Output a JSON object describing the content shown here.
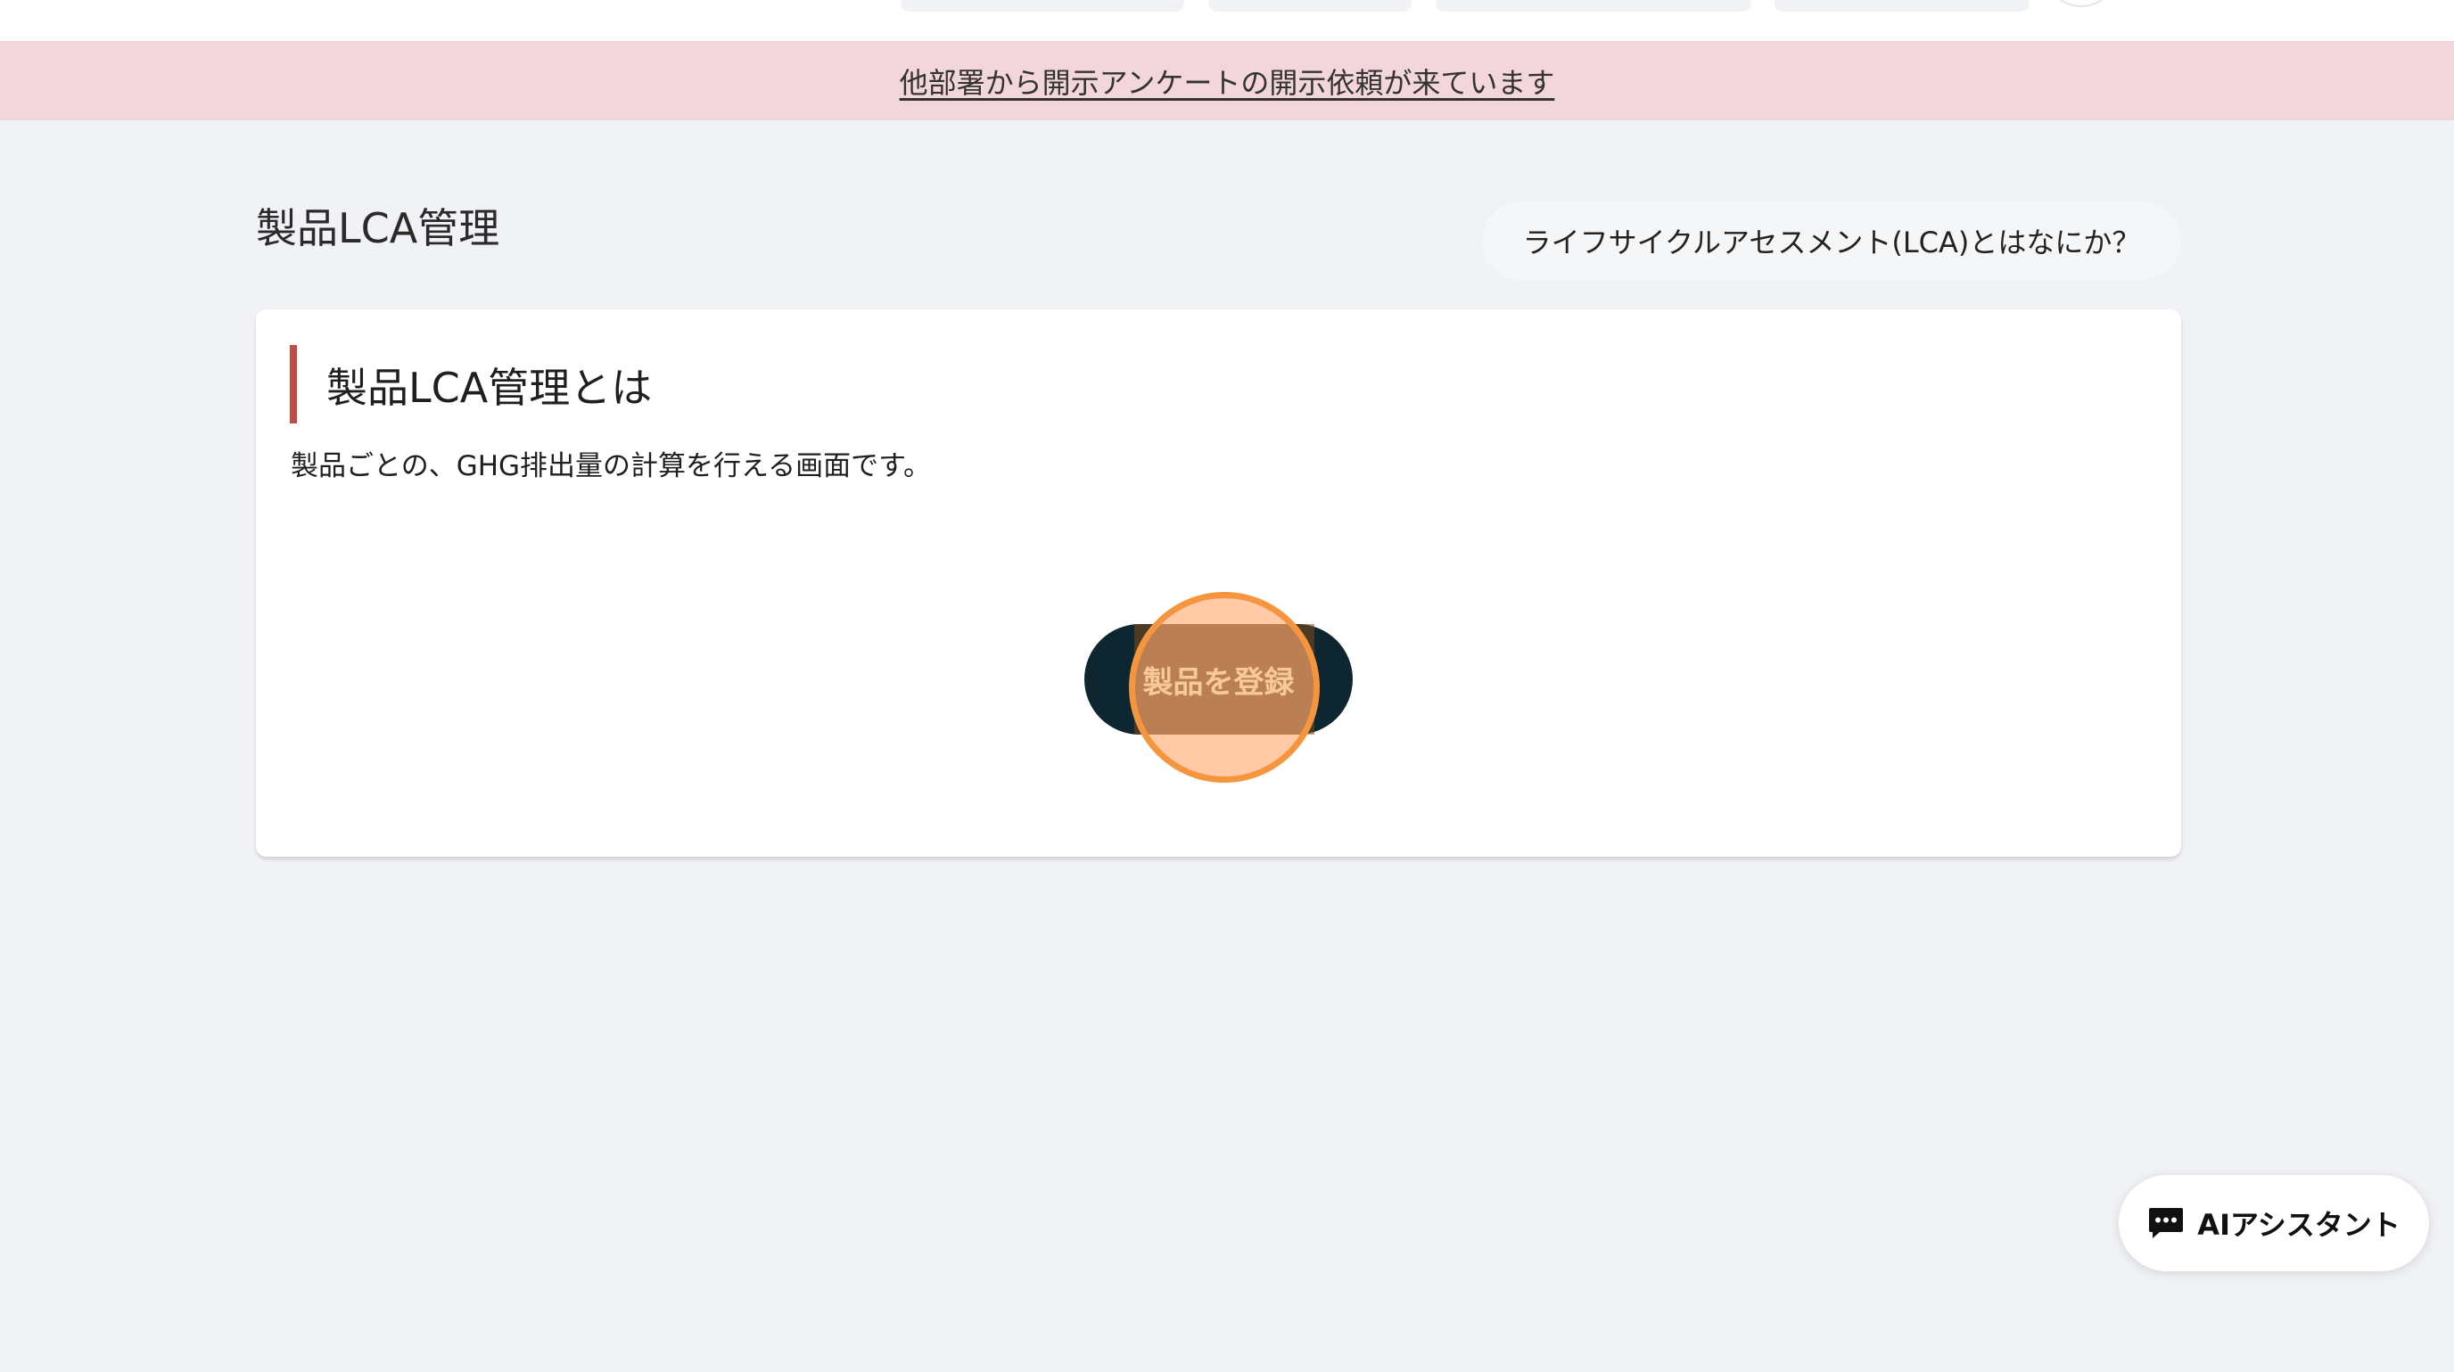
{
  "banner": {
    "text": "他部署から開示アンケートの開示依頼が来ています"
  },
  "header": {
    "page_title": "製品LCA管理",
    "help_link": "ライフサイクルアセスメント(LCA)とはなにか？"
  },
  "card": {
    "heading": "製品LCA管理とは",
    "description": "製品ごとの、GHG排出量の計算を行える画面です。",
    "register_button": "製品を登録"
  },
  "assistant": {
    "label": "AIアシスタント",
    "icon": "chat-icon"
  },
  "colors": {
    "banner_bg": "#f3d6dc",
    "accent": "#c24b43",
    "primary_button": "#0e2630",
    "click_highlight": "#f5953e"
  }
}
